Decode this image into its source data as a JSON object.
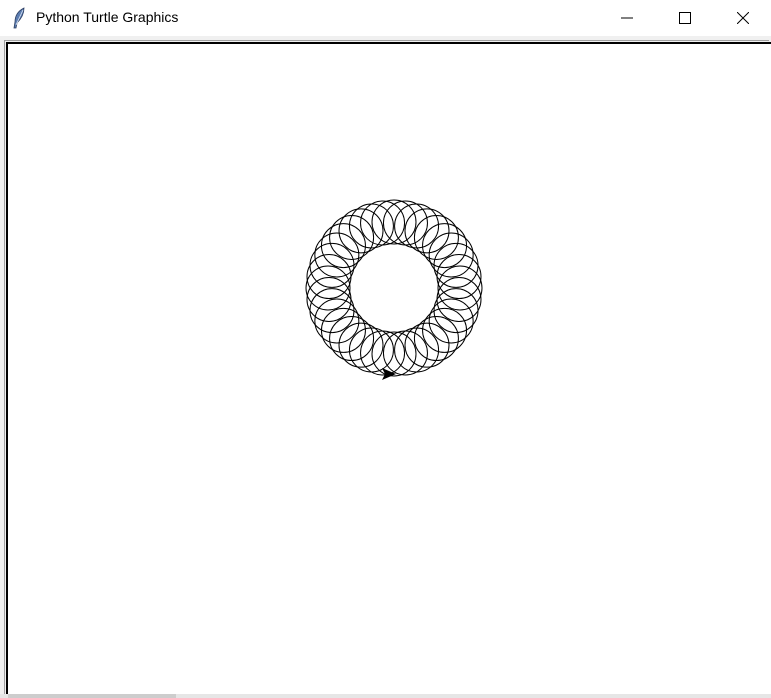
{
  "window": {
    "title": "Python Turtle Graphics",
    "app_icon": "feather-icon",
    "controls": {
      "minimize": "minimize-icon",
      "maximize": "maximize-icon",
      "close": "close-icon"
    }
  },
  "canvas": {
    "background": "#ffffff",
    "pen_color": "#000000",
    "drawing": "spirograph-ring",
    "circle_count": 36,
    "turtle_icon": "turtle-arrow-icon"
  }
}
